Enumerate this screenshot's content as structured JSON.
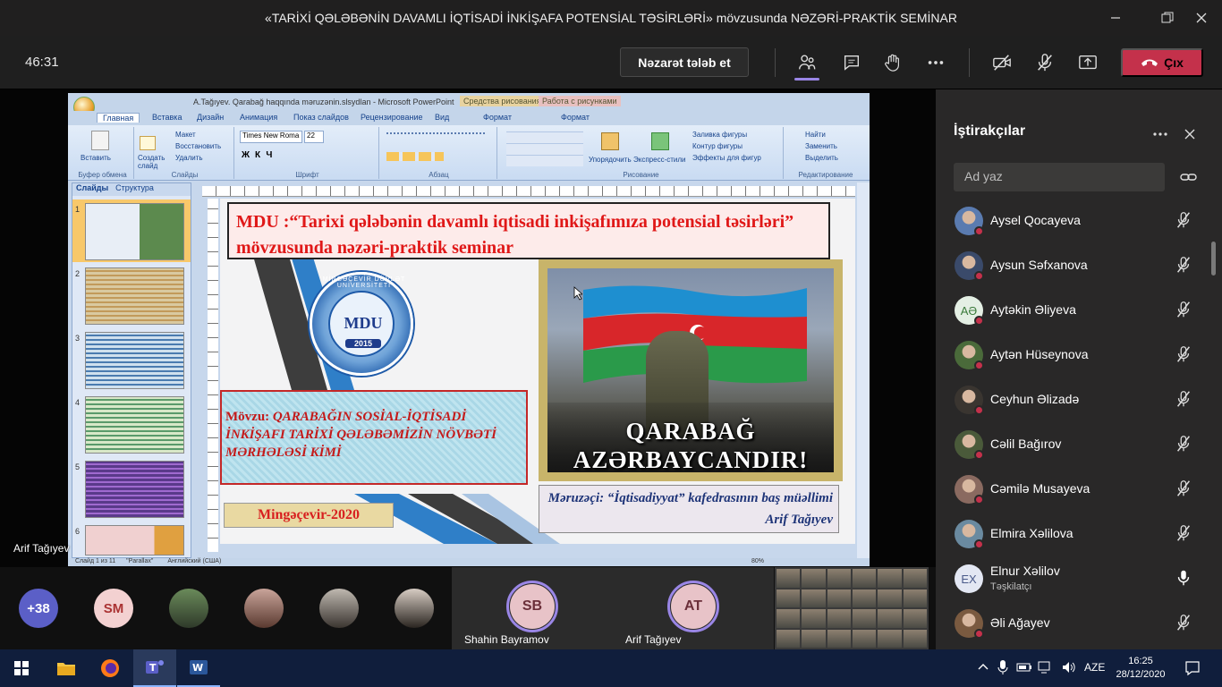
{
  "window": {
    "title": "«TARİXİ QƏLƏBƏNİN DAVAMLI İQTİSADİ İNKİŞAFA POTENSİAL TƏSİRLƏRİ» mövzusunda NƏZƏRİ-PRAKTİK SEMİNAR"
  },
  "toolbar": {
    "timer": "46:31",
    "request_control_label": "Nəzarət tələb et",
    "leave_label": "Çıx"
  },
  "share": {
    "presenter": "Arif Tağıyev",
    "powerpoint": {
      "window_title": "A.Tağıyev. Qarabağ haqqında məruzənin.slsydlan - Microsoft PowerPoint",
      "context_tab_1": "Средства рисования",
      "context_tab_2": "Работа с рисунками",
      "tabs": [
        "Главная",
        "Вставка",
        "Дизайн",
        "Анимация",
        "Показ слайдов",
        "Рецензирование",
        "Вид",
        "Формат",
        "Формат"
      ],
      "ribbon": {
        "paste": "Вставить",
        "clipboard_caption": "Буфер обмена",
        "layout": "Макет",
        "reset": "Восстановить",
        "delete": "Удалить",
        "new_slide": "Создать слайд",
        "slides_caption": "Слайды",
        "font_name": "Times New Roma",
        "font_size": "22",
        "font_caption": "Шрифт",
        "paragraph_caption": "Абзац",
        "arrange": "Упорядочить",
        "express_styles": "Экспресс-стили",
        "shape_fill": "Заливка фигуры",
        "shape_outline": "Контур фигуры",
        "shape_effects": "Эффекты для фигур",
        "drawing_caption": "Рисование",
        "find": "Найти",
        "replace": "Заменить",
        "select": "Выделить",
        "editing_caption": "Редактирование"
      },
      "panel_tabs": [
        "Слайды",
        "Структура"
      ],
      "thumb_numbers": [
        "1",
        "2",
        "3",
        "4",
        "5",
        "6"
      ],
      "status": {
        "slide_counter": "Слайд 1 из 11",
        "theme": "\"Parallax\"",
        "language": "Английский (США)",
        "zoom": "80%"
      }
    },
    "slide": {
      "title": "MDU :“Tarixi qələbənin davamlı  iqtisadi inkişafımıza potensial təsirləri” mövzusunda nəzəri-praktik seminar",
      "logo_text": "MDU",
      "logo_year": "2015",
      "logo_ring_text": "MİNGƏÇEVİR DÖVLƏT UNİVERSİTETİ",
      "topic_label": "Mövzu:",
      "topic_text": "QARABAĞIN  SOSİAL-İQTİSADİ  İNKİŞAFI  TARİXİ  QƏLƏBƏMİZİN  NÖVBƏTİ  MƏRHƏLƏSİ  KİMİ",
      "city": "Mingəçevir-2020",
      "poster_line1": "QARABAĞ",
      "poster_line2": "AZƏRBAYCANDIR!",
      "speaker": "Məruzəçi:    “İqtisadiyyat” kafedrasının baş müəllimi  Arif  Tağıyev"
    }
  },
  "strip": {
    "overflow_count": "+38",
    "initials_sm": "SM",
    "tile1_initials": "SB",
    "tile1_name": "Shahin Bayramov",
    "tile2_initials": "AT",
    "tile2_name": "Arif Tağıyev"
  },
  "panel": {
    "title": "İştirakçılar",
    "search_placeholder": "Ad yaz",
    "participants": [
      {
        "name": "Aysel Qocayeva",
        "role": ""
      },
      {
        "name": "Aysun Səfxanova",
        "role": ""
      },
      {
        "name": "Aytəkin Əliyeva",
        "role": "",
        "initials": "AƏ"
      },
      {
        "name": "Aytən Hüseynova",
        "role": ""
      },
      {
        "name": "Ceyhun Əlizadə",
        "role": ""
      },
      {
        "name": "Cəlil Bağırov",
        "role": ""
      },
      {
        "name": "Cəmilə Musayeva",
        "role": ""
      },
      {
        "name": "Elmira Xəlilova",
        "role": ""
      },
      {
        "name": "Elnur Xəlilov",
        "role": "Təşkilatçı",
        "initials": "EX"
      },
      {
        "name": "Əli Ağayev",
        "role": ""
      }
    ]
  },
  "taskbar": {
    "language": "AZE",
    "time": "16:25",
    "date": "28/12/2020"
  },
  "colors": {
    "leave": "#c4314b",
    "accent": "#9a86e6",
    "slide_title": "#e01818"
  }
}
